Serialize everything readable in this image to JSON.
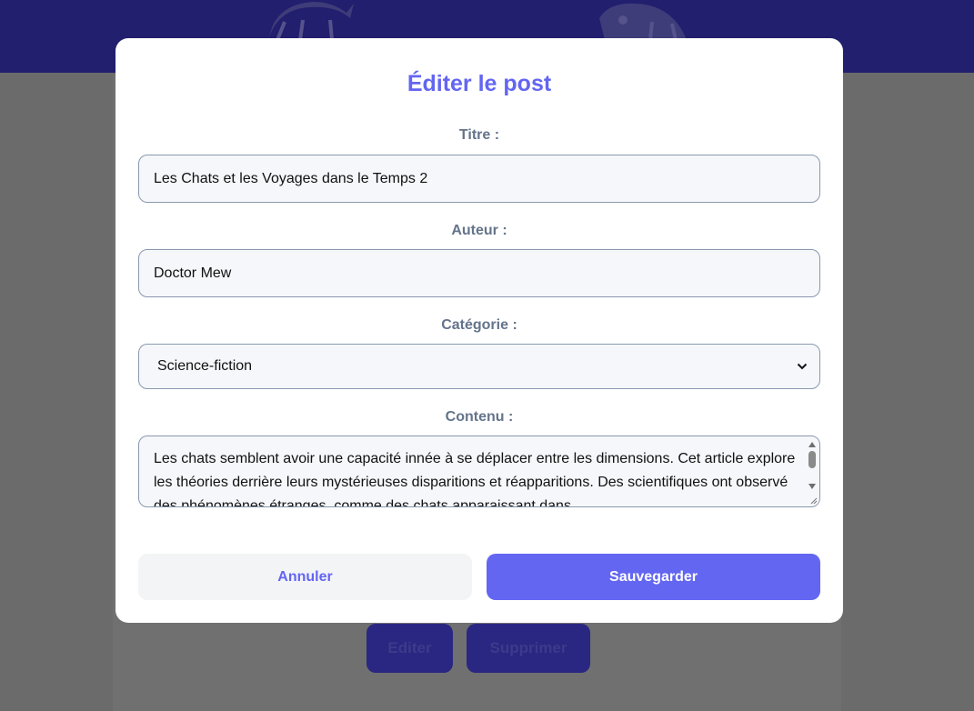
{
  "modal": {
    "title": "Éditer le post",
    "fields": {
      "title": {
        "label": "Titre :",
        "value": "Les Chats et les Voyages dans le Temps 2"
      },
      "author": {
        "label": "Auteur :",
        "value": "Doctor Mew"
      },
      "category": {
        "label": "Catégorie :",
        "selected": "Science-fiction"
      },
      "content": {
        "label": "Contenu :",
        "value": "Les chats semblent avoir une capacité innée à se déplacer entre les dimensions. Cet article explore les théories derrière leurs mystérieuses disparitions et réapparitions. Des scientifiques ont observé des phénomènes étranges, comme des chats apparaissant dans"
      }
    },
    "buttons": {
      "cancel": "Annuler",
      "save": "Sauvegarder"
    }
  },
  "background": {
    "buttons": {
      "edit": "Editer",
      "delete": "Supprimer"
    }
  },
  "colors": {
    "accent": "#6366f1",
    "header": "#221f6e",
    "overlay": "#6b6b6b"
  }
}
